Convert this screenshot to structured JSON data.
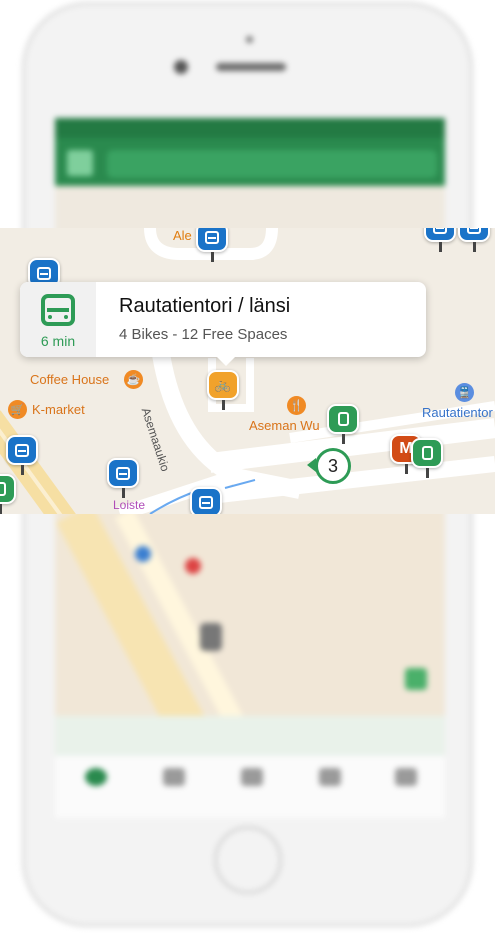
{
  "callout": {
    "time": "6 min",
    "title": "Rautatientori / länsi",
    "subtitle": "4 Bikes - 12 Free Spaces"
  },
  "map": {
    "labels": {
      "coffee_house": "Coffee House",
      "k_market": "K-market",
      "asemaaukio": "Asemaaukio",
      "aseman_wu": "Aseman Wu",
      "rautatientori": "Rautatientor",
      "loiste": "Loiste",
      "ale": "Ale"
    },
    "cluster_count": "3"
  },
  "colors": {
    "transit_green": "#2e9b56",
    "bus_blue": "#1a73c8",
    "bike_orange": "#f1a22b",
    "metro_red": "#d24b16",
    "poi_orange": "#f08a24"
  }
}
